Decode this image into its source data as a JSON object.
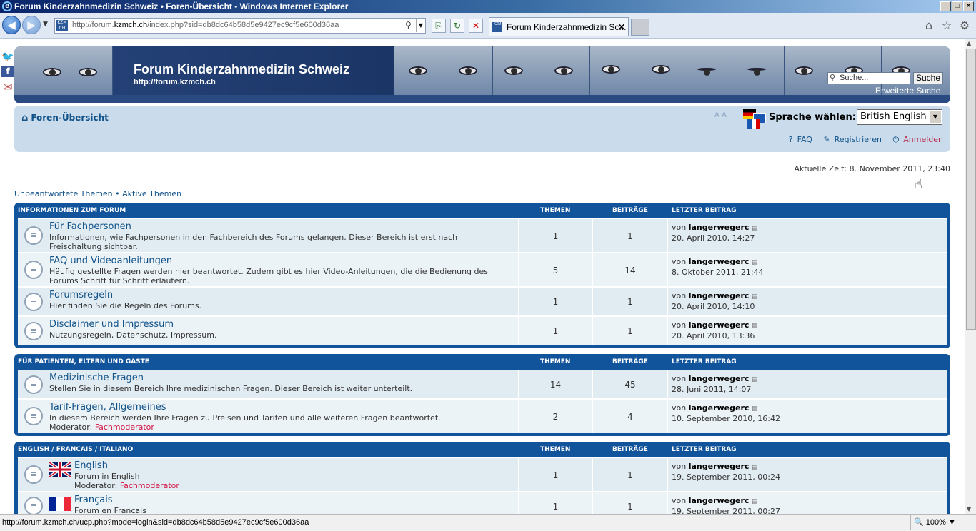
{
  "window": {
    "title": "Forum Kinderzahnmedizin Schweiz • Foren-Übersicht - Windows Internet Explorer"
  },
  "browser": {
    "url_prefix": "http://forum.",
    "url_host": "kzmch.ch",
    "url_rest": "/index.php?sid=db8dc64b58d5e9427ec9cf5e600d36aa",
    "site_badge": "KZM CH",
    "tab_title": "Forum Kinderzahnmedizin Sc...",
    "status_url": "http://forum.kzmch.ch/ucp.php?mode=login&sid=db8dc64b58d5e9427ec9cf5e600d36aa",
    "zoom": "100%"
  },
  "header": {
    "title": "Forum Kinderzahnmedizin Schweiz",
    "url": "http://forum.kzmch.ch",
    "search_placeholder": "Suche...",
    "search_button": "Suche",
    "advanced_search": "Erweiterte Suche"
  },
  "nav": {
    "home": "Foren-Übersicht",
    "font_size": "A A",
    "language_label": "Sprache wählen:",
    "language_value": "British English",
    "faq": "FAQ",
    "register": "Registrieren",
    "login": "Anmelden"
  },
  "current_time": "Aktuelle Zeit: 8. November 2011, 23:40",
  "quicklinks": {
    "unanswered": "Unbeantwortete Themen",
    "sep": " • ",
    "active": "Aktive Themen"
  },
  "columns": {
    "topics": "THEMEN",
    "posts": "BEITRÄGE",
    "last": "LETZTER BEITRAG"
  },
  "categories": [
    {
      "title": "INFORMATIONEN ZUM FORUM",
      "forums": [
        {
          "name": "Für Fachpersonen",
          "desc": "Informationen, wie Fachpersonen in den Fachbereich des Forums gelangen. Dieser Bereich ist erst nach Freischaltung sichtbar.",
          "topics": "1",
          "posts": "1",
          "by": "von ",
          "user": "langerwegerc",
          "date": "20. April 2010, 14:27"
        },
        {
          "name": "FAQ und Videoanleitungen",
          "desc": "Häufig gestellte Fragen werden hier beantwortet. Zudem gibt es hier Video-Anleitungen, die die Bedienung des Forums Schritt für Schritt erläutern.",
          "topics": "5",
          "posts": "14",
          "by": "von ",
          "user": "langerwegerc",
          "date": "8. Oktober 2011, 21:44"
        },
        {
          "name": "Forumsregeln",
          "desc": "Hier finden Sie die Regeln des Forums.",
          "topics": "1",
          "posts": "1",
          "by": "von ",
          "user": "langerwegerc",
          "date": "20. April 2010, 14:10"
        },
        {
          "name": "Disclaimer und Impressum",
          "desc": "Nutzungsregeln, Datenschutz, Impressum.",
          "topics": "1",
          "posts": "1",
          "by": "von ",
          "user": "langerwegerc",
          "date": "20. April 2010, 13:36"
        }
      ]
    },
    {
      "title": "FÜR PATIENTEN, ELTERN UND GÄSTE",
      "forums": [
        {
          "name": "Medizinische Fragen",
          "desc": "Stellen Sie in diesem Bereich Ihre medizinischen Fragen. Dieser Bereich ist weiter unterteilt.",
          "topics": "14",
          "posts": "45",
          "by": "von ",
          "user": "langerwegerc",
          "date": "28. Juni 2011, 14:07"
        },
        {
          "name": "Tarif-Fragen, Allgemeines",
          "desc": "In diesem Bereich werden Ihre Fragen zu Preisen und Tarifen und alle weiteren Fragen beantwortet.",
          "mod_label": "Moderator: ",
          "mod": "Fachmoderator",
          "topics": "2",
          "posts": "4",
          "by": "von ",
          "user": "langerwegerc",
          "date": "10. September 2010, 16:42"
        }
      ]
    },
    {
      "title": "ENGLISH / FRANÇAIS / ITALIANO",
      "forums": [
        {
          "name": "English",
          "desc": "Forum in English",
          "mod_label": "Moderator: ",
          "mod": "Fachmoderator",
          "topics": "1",
          "posts": "1",
          "by": "von ",
          "user": "langerwegerc",
          "date": "19. September 2011, 00:24"
        },
        {
          "name": "Français",
          "desc": "Forum en Français",
          "topics": "1",
          "posts": "1",
          "by": "von ",
          "user": "langerwegerc",
          "date": "19. September 2011, 00:27"
        }
      ]
    }
  ]
}
